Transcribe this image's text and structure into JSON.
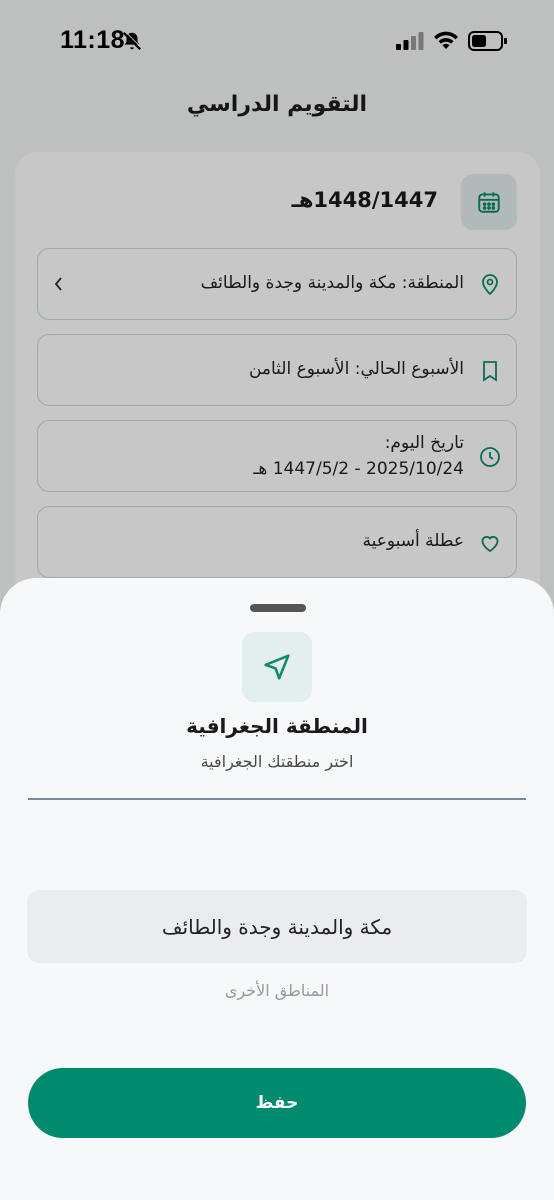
{
  "status_bar": {
    "time": "11:18"
  },
  "header": {
    "title": "التقويم الدراسي"
  },
  "card": {
    "year": "1448/1447هـ",
    "region_text": "المنطقة: مكة والمدينة وجدة والطائف",
    "week_text": "الأسبوع الحالي: الأسبوع الثامن",
    "date_label": "تاريخ اليوم:",
    "date_value": "2025/10/24 - 1447/5/2 هـ",
    "holiday_text": "عطلة أسبوعية"
  },
  "sheet": {
    "title": "المنطقة الجغرافية",
    "subtitle": "اختر منطقتك الجغرافية",
    "selected_option": "مكة والمدينة وجدة والطائف",
    "other_option": "المناطق الأخرى",
    "save_label": "حفظ"
  },
  "colors": {
    "accent": "#008a6e",
    "accent_light": "#e3efec",
    "row_border": "#bfe0d4"
  },
  "icons": {
    "calendar": "calendar-icon",
    "location": "location-pin-icon",
    "bookmark": "bookmark-icon",
    "clock": "clock-icon",
    "heart": "heart-icon",
    "navigation": "navigation-arrow-icon",
    "chevron": "chevron-left-icon",
    "bell_off": "bell-off-icon"
  }
}
